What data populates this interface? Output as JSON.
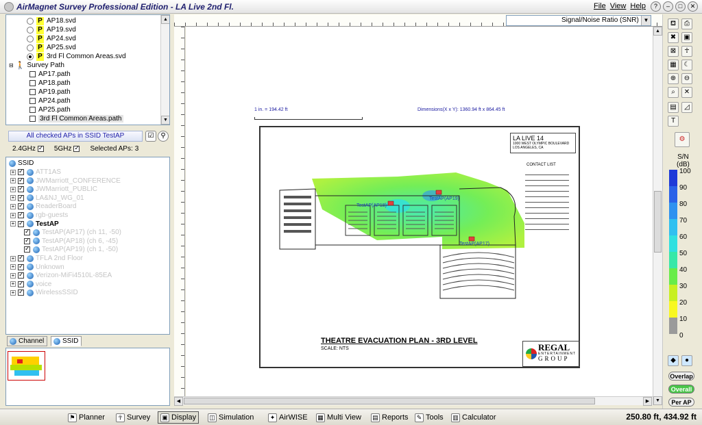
{
  "window": {
    "title": "AirMagnet Survey Professional Edition - LA Live 2nd Fl.",
    "menu": [
      "File",
      "View",
      "Help"
    ],
    "controls": [
      "?",
      "–",
      "□",
      "✕"
    ]
  },
  "survey_tree": {
    "svd_files": [
      {
        "label": "AP18.svd",
        "selected": false
      },
      {
        "label": "AP19.svd",
        "selected": false
      },
      {
        "label": "AP24.svd",
        "selected": false
      },
      {
        "label": "AP25.svd",
        "selected": false
      },
      {
        "label": "3rd Fl Common Areas.svd",
        "selected": true
      }
    ],
    "badge": "P",
    "survey_path_label": "Survey Path",
    "paths": [
      "AP17.path",
      "AP18.path",
      "AP19.path",
      "AP24.path",
      "AP25.path",
      "3rd Fl Common Areas.path"
    ]
  },
  "filter": {
    "title": "All checked APs in SSID TestAP",
    "band_24": "2.4GHz",
    "band_5": "5GHz",
    "selected_label": "Selected APs:",
    "selected_count": "3"
  },
  "ssid_tree": {
    "root": "SSID",
    "items": [
      {
        "label": "ATT1AS",
        "dim": true
      },
      {
        "label": "JWMarriott_CONFERENCE",
        "dim": true
      },
      {
        "label": "JWMarriott_PUBLIC",
        "dim": true
      },
      {
        "label": "LA&NJ_WG_01",
        "dim": true
      },
      {
        "label": "ReaderBoard",
        "dim": true
      },
      {
        "label": "rgb-guests",
        "dim": true
      },
      {
        "label": "TestAP",
        "dim": false
      },
      {
        "label": "TestAP(AP17) (ch 11, -50)",
        "dim": true,
        "child": true
      },
      {
        "label": "TestAP(AP18) (ch 6, -45)",
        "dim": true,
        "child": true
      },
      {
        "label": "TestAP(AP19) (ch 1, -50)",
        "dim": true,
        "child": true
      },
      {
        "label": "TFLA 2nd Floor",
        "dim": true
      },
      {
        "label": "Unknown",
        "dim": true
      },
      {
        "label": "Verizon-MiFi4510L-85EA",
        "dim": true
      },
      {
        "label": "voice",
        "dim": true
      },
      {
        "label": "WirelessSSID",
        "dim": true
      }
    ]
  },
  "tabs": [
    {
      "label": "Channel",
      "active": false
    },
    {
      "label": "SSID",
      "active": true
    }
  ],
  "canvas": {
    "measure_dropdown": "Signal/Noise Ratio (SNR)",
    "scale_label": "1 in. = 194.42 ft",
    "dimensions_label": "Dimensions(X x Y): 1360.94 ft x 864.45 ft",
    "plan": {
      "title": "THEATRE EVACUATION PLAN - 3RD LEVEL",
      "scale": "SCALE: NTS",
      "venue": "LA LIVE 14",
      "address_1": "1000 WEST OLYMPIC BOULEVARD",
      "address_2": "LOS ANGELES, CA",
      "contact": "CONTACT LIST",
      "ap_labels": [
        "TestAP(AP18)",
        "TestAP(AP19)",
        "TestAP(AP17)"
      ],
      "brand": "REGAL",
      "brand_sub": "ENTERTAINMENT",
      "brand_group": "GROUP"
    }
  },
  "legend": {
    "title": "S/N",
    "unit": "(dB)",
    "ticks": [
      "100",
      "90",
      "80",
      "70",
      "60",
      "50",
      "40",
      "30",
      "20",
      "10",
      "0"
    ],
    "colors": [
      "#1e3ad8",
      "#2a62e8",
      "#2f92f0",
      "#30c0f0",
      "#30e0e0",
      "#38e8a8",
      "#68ec48",
      "#c8f020",
      "#f8f820",
      "#9a9a9a"
    ]
  },
  "side_buttons": [
    "Overlap",
    "Overall",
    "Per AP"
  ],
  "bottom_toolbar": [
    {
      "label": "Planner",
      "icon": "planner-icon",
      "active": false
    },
    {
      "label": "Survey",
      "icon": "survey-icon",
      "active": false
    },
    {
      "label": "Display",
      "icon": "display-icon",
      "active": true
    },
    {
      "label": "Simulation",
      "icon": "simulation-icon",
      "active": false
    },
    {
      "label": "AirWISE",
      "icon": "airwise-icon",
      "active": false
    },
    {
      "label": "Multi View",
      "icon": "multi-view-icon",
      "active": false
    },
    {
      "label": "Reports",
      "icon": "reports-icon",
      "active": false
    },
    {
      "label": "Tools",
      "icon": "tools-icon",
      "active": false
    },
    {
      "label": "Calculator",
      "icon": "calculator-icon",
      "active": false
    }
  ],
  "status": {
    "coordinates": "250.80 ft, 434.92 ft"
  }
}
